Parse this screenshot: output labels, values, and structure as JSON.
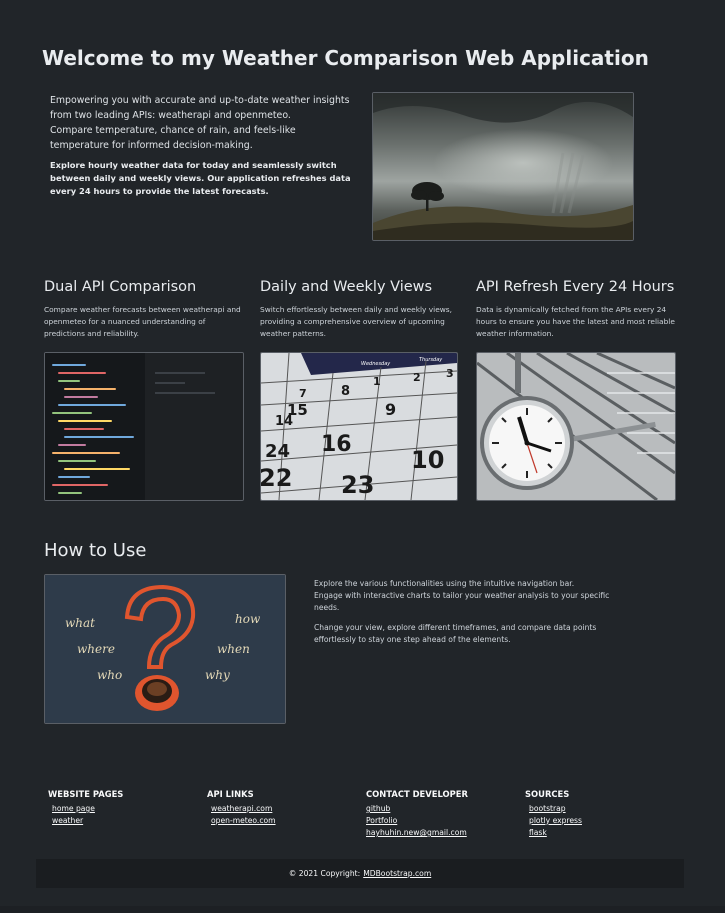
{
  "header": {
    "title": "Welcome to my Weather Comparison Web Application"
  },
  "intro": {
    "lines": [
      "Empowering you with accurate and up-to-date weather insights from two leading APIs: weatherapi and openmeteo.",
      "Compare temperature, chance of rain, and feels-like temperature for informed decision-making."
    ],
    "bold_text": "Explore hourly weather data for today and seamlessly switch between daily and weekly views. Our application refreshes data every 24 hours to provide the latest forecasts."
  },
  "features": [
    {
      "title": "Dual API Comparison",
      "text": "Compare weather forecasts between weatherapi and openmeteo for a nuanced understanding of predictions and reliability."
    },
    {
      "title": "Daily and Weekly Views",
      "text": "Switch effortlessly between daily and weekly views, providing a comprehensive overview of upcoming weather patterns."
    },
    {
      "title": "API Refresh Every 24 Hours",
      "text": "Data is dynamically fetched from the APIs every 24 hours to ensure you have the latest and most reliable weather information."
    }
  ],
  "calendar_numbers": [
    "1",
    "2",
    "3",
    "7",
    "8",
    "9",
    "14",
    "15",
    "16",
    "10",
    "22",
    "23",
    "24"
  ],
  "calendar_days": [
    "Wednesday",
    "Thursday"
  ],
  "howto": {
    "title": "How to Use",
    "p1_line1": "Explore the various functionalities using the intuitive navigation bar.",
    "p1_line2": "Engage with interactive charts to tailor your weather analysis to your specific needs.",
    "p2": "Change your view, explore different timeframes, and compare data points effortlessly to stay one step ahead of the elements.",
    "chalk_words": [
      "what",
      "where",
      "who",
      "how",
      "when",
      "why"
    ]
  },
  "footer": {
    "columns": [
      {
        "title": "WEBSITE PAGES",
        "links": [
          "home page",
          "weather"
        ]
      },
      {
        "title": "API LINKS",
        "links": [
          "weatherapi.com",
          "open-meteo.com"
        ]
      },
      {
        "title": "CONTACT DEVELOPER",
        "links": [
          "github",
          "Portfolio",
          "hayhuhin.new@gmail.com"
        ]
      },
      {
        "title": "SOURCES",
        "links": [
          "bootstrap",
          "plotly express",
          "flask"
        ]
      }
    ],
    "copyright_prefix": "© 2021 Copyright:",
    "copyright_link": "MDBootstrap.com"
  },
  "colors": {
    "background": "#212529",
    "footer_bar": "#1a1d20",
    "chalk_question_mark": "#e0552e"
  }
}
